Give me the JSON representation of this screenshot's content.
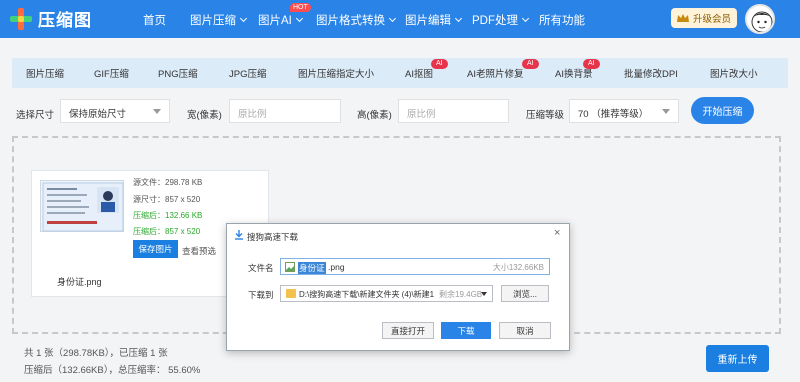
{
  "brand": {
    "name": "压缩图"
  },
  "nav": {
    "items": [
      {
        "label": "首页",
        "has_menu": false
      },
      {
        "label": "图片压缩",
        "has_menu": true
      },
      {
        "label": "图片AI",
        "has_menu": true,
        "badge": "HOT"
      },
      {
        "label": "图片格式转换",
        "has_menu": true
      },
      {
        "label": "图片编辑",
        "has_menu": true
      },
      {
        "label": "PDF处理",
        "has_menu": true
      },
      {
        "label": "所有功能",
        "has_menu": false
      }
    ],
    "vip_label": "升级会员"
  },
  "tabs": [
    {
      "label": "图片压缩"
    },
    {
      "label": "GIF压缩"
    },
    {
      "label": "PNG压缩"
    },
    {
      "label": "JPG压缩"
    },
    {
      "label": "图片压缩指定大小"
    },
    {
      "label": "AI抠图",
      "badge": "AI"
    },
    {
      "label": "AI老照片修复",
      "badge": "AI"
    },
    {
      "label": "AI换背景",
      "badge": "AI"
    },
    {
      "label": "批量修改DPI"
    },
    {
      "label": "图片改大小"
    }
  ],
  "options": {
    "size_label": "选择尺寸",
    "size_value": "保持原始尺寸",
    "width_label": "宽(像素)",
    "width_placeholder": "原比例",
    "height_label": "高(像素)",
    "height_placeholder": "原比例",
    "level_label": "压缩等级",
    "level_value": "70 （推荐等级）",
    "start_label": "开始压缩"
  },
  "file_card": {
    "source_file": "源文件：298.78 KB",
    "source_size": "源尺寸：857 x 520",
    "compressed": "压缩后：132.66 KB",
    "compressed_size": "压缩后：857 x 520",
    "save_label": "保存图片",
    "preview_label": "查看预选",
    "file_name": "身份证.png"
  },
  "stats": {
    "line1": "共 1 张（298.78KB），已压缩 1 张",
    "line2": "压缩后（132.66KB），总压缩率： 55.60%",
    "reupload_label": "重新上传"
  },
  "dialog": {
    "title": "搜狗高速下载",
    "filename_label": "文件名",
    "filename_selected": "身份证",
    "filename_rest": ".png",
    "size_text": "大小132.66KB",
    "saveto_label": "下载到",
    "path": "D:\\搜狗高速下载\\新建文件夹 (4)\\新建1",
    "free_space": "剩余19.4GB",
    "browse_label": "浏览...",
    "open_label": "直接打开",
    "download_label": "下载",
    "cancel_label": "取消"
  },
  "colors": {
    "brand_blue": "#2a84e8",
    "accent_red": "#e8344a",
    "success_green": "#2aa82a"
  }
}
